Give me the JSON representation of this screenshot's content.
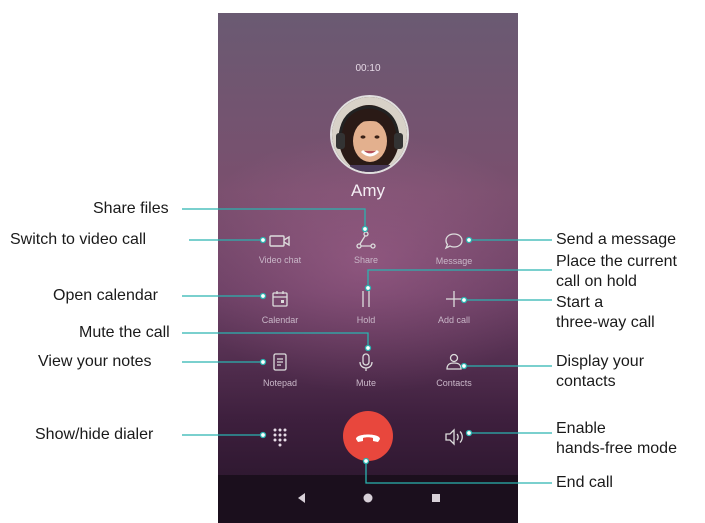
{
  "call": {
    "timer": "00:10",
    "contact_name": "Amy"
  },
  "buttons": {
    "video_chat": "Video chat",
    "share": "Share",
    "message": "Message",
    "calendar": "Calendar",
    "hold": "Hold",
    "add_call": "Add call",
    "notepad": "Notepad",
    "mute": "Mute",
    "contacts": "Contacts"
  },
  "callouts": {
    "share_files": "Share files",
    "switch_video": "Switch to video call",
    "open_calendar": "Open calendar",
    "mute_call": "Mute the call",
    "view_notes": "View your notes",
    "show_dialer": "Show/hide dialer",
    "send_message": "Send a message",
    "hold_line1": "Place the current",
    "hold_line2": "call on hold",
    "three_way_line1": "Start a",
    "three_way_line2": "three-way call",
    "contacts_line1": "Display your",
    "contacts_line2": "contacts",
    "handsfree_line1": "Enable",
    "handsfree_line2": "hands-free mode",
    "end_call": "End call"
  },
  "colors": {
    "end_call": "#e8473d",
    "leader_line": "#2ab3b0"
  },
  "icons": [
    "video-camera-icon",
    "share-icon",
    "message-bubble-icon",
    "calendar-icon",
    "hold-icon",
    "plus-icon",
    "notepad-icon",
    "microphone-icon",
    "contacts-icon",
    "dialpad-icon",
    "end-call-icon",
    "speaker-icon",
    "back-icon",
    "home-icon",
    "recents-icon"
  ]
}
